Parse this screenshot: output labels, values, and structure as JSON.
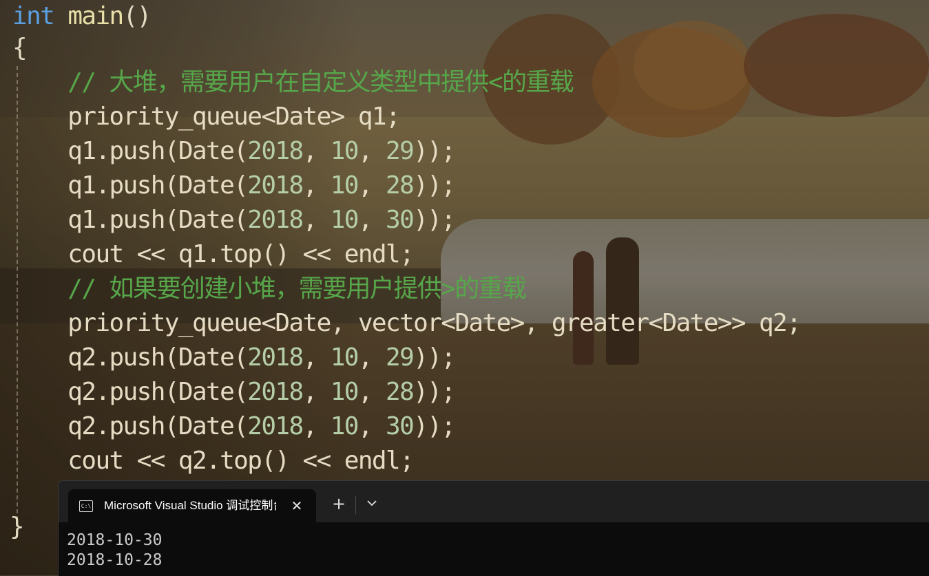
{
  "editor": {
    "lines": [
      {
        "parts": [
          {
            "t": "int",
            "c": "kw"
          },
          {
            "t": " ",
            "c": ""
          },
          {
            "t": "main",
            "c": "fn"
          },
          {
            "t": "()",
            "c": ""
          }
        ]
      },
      {
        "parts": [
          {
            "t": "{",
            "c": ""
          }
        ]
      },
      {
        "parts": [
          {
            "t": "    ",
            "c": ""
          },
          {
            "t": "// 大堆，需要用户在自定义类型中提供<的重载",
            "c": "cm"
          }
        ]
      },
      {
        "parts": [
          {
            "t": "    priority_queue<Date> q1;",
            "c": ""
          }
        ]
      },
      {
        "parts": [
          {
            "t": "    q1.push(Date(",
            "c": ""
          },
          {
            "t": "2018",
            "c": "num"
          },
          {
            "t": ", ",
            "c": ""
          },
          {
            "t": "10",
            "c": "num"
          },
          {
            "t": ", ",
            "c": ""
          },
          {
            "t": "29",
            "c": "num"
          },
          {
            "t": "));",
            "c": ""
          }
        ]
      },
      {
        "parts": [
          {
            "t": "    q1.push(Date(",
            "c": ""
          },
          {
            "t": "2018",
            "c": "num"
          },
          {
            "t": ", ",
            "c": ""
          },
          {
            "t": "10",
            "c": "num"
          },
          {
            "t": ", ",
            "c": ""
          },
          {
            "t": "28",
            "c": "num"
          },
          {
            "t": "));",
            "c": ""
          }
        ]
      },
      {
        "parts": [
          {
            "t": "    q1.push(Date(",
            "c": ""
          },
          {
            "t": "2018",
            "c": "num"
          },
          {
            "t": ", ",
            "c": ""
          },
          {
            "t": "10",
            "c": "num"
          },
          {
            "t": ", ",
            "c": ""
          },
          {
            "t": "30",
            "c": "num"
          },
          {
            "t": "));",
            "c": ""
          }
        ]
      },
      {
        "parts": [
          {
            "t": "    cout << q1.top() << endl;",
            "c": ""
          }
        ]
      },
      {
        "parts": [
          {
            "t": "    ",
            "c": ""
          },
          {
            "t": "// 如果要创建小堆，需要用户提供>的重载",
            "c": "cm"
          }
        ]
      },
      {
        "parts": [
          {
            "t": "    priority_queue<Date, vector<Date>, greater<Date>> q2;",
            "c": ""
          }
        ]
      },
      {
        "parts": [
          {
            "t": "    q2.push(Date(",
            "c": ""
          },
          {
            "t": "2018",
            "c": "num"
          },
          {
            "t": ", ",
            "c": ""
          },
          {
            "t": "10",
            "c": "num"
          },
          {
            "t": ", ",
            "c": ""
          },
          {
            "t": "29",
            "c": "num"
          },
          {
            "t": "));",
            "c": ""
          }
        ]
      },
      {
        "parts": [
          {
            "t": "    q2.push(Date(",
            "c": ""
          },
          {
            "t": "2018",
            "c": "num"
          },
          {
            "t": ", ",
            "c": ""
          },
          {
            "t": "10",
            "c": "num"
          },
          {
            "t": ", ",
            "c": ""
          },
          {
            "t": "28",
            "c": "num"
          },
          {
            "t": "));",
            "c": ""
          }
        ]
      },
      {
        "parts": [
          {
            "t": "    q2.push(Date(",
            "c": ""
          },
          {
            "t": "2018",
            "c": "num"
          },
          {
            "t": ", ",
            "c": ""
          },
          {
            "t": "10",
            "c": "num"
          },
          {
            "t": ", ",
            "c": ""
          },
          {
            "t": "30",
            "c": "num"
          },
          {
            "t": "));",
            "c": ""
          }
        ]
      },
      {
        "parts": [
          {
            "t": "    cout << q2.top() << endl;",
            "c": ""
          }
        ]
      }
    ],
    "closing_brace": "}",
    "colors": {
      "keyword": "#5aa0e0",
      "comment": "#57a64a",
      "number": "#b5cea8",
      "text": "#e6dcc4"
    }
  },
  "terminal": {
    "tab_title": "Microsoft Visual Studio 调试控制台",
    "tab_icon": "terminal-icon",
    "close_glyph": "✕",
    "new_tab_glyph": "+",
    "dropdown_icon": "chevron-down-icon",
    "output": [
      "2018-10-30",
      "2018-10-28"
    ]
  }
}
